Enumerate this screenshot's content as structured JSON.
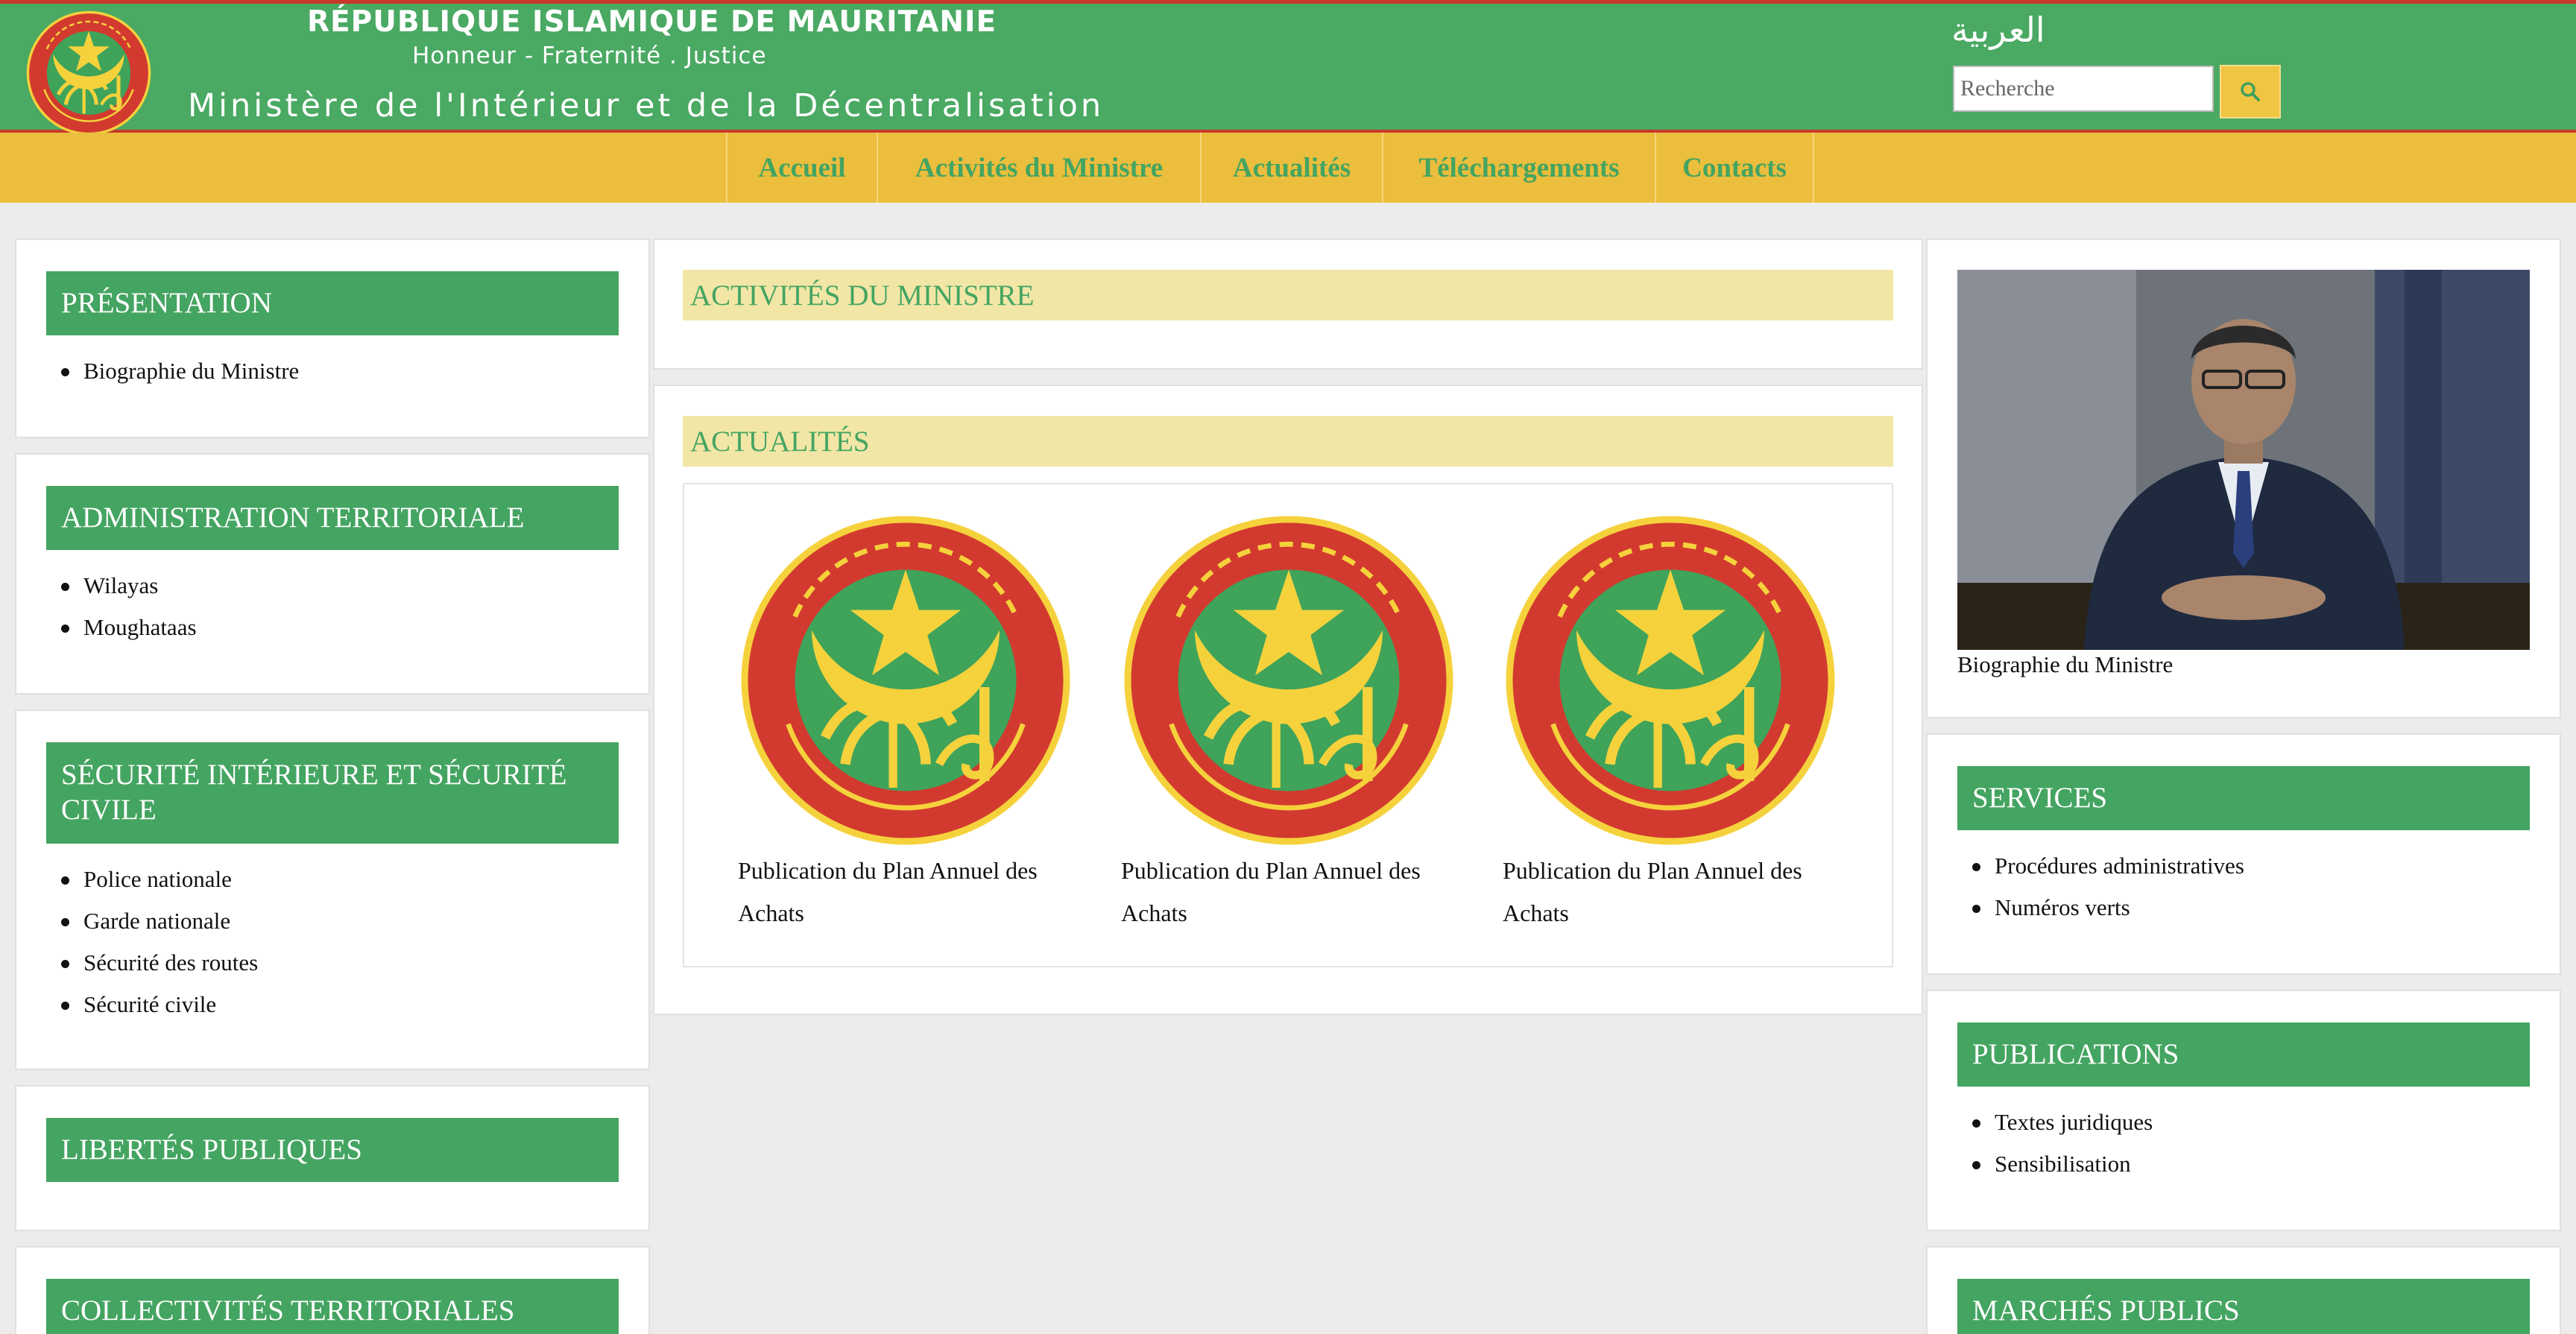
{
  "header": {
    "republic_title": "RÉPUBLIQUE ISLAMIQUE DE MAURITANIE",
    "motto": "Honneur - Fraternité . Justice",
    "ministry_title": "Ministère de l'Intérieur et de la Décentralisation",
    "language_link": "العربية",
    "search_placeholder": "Recherche",
    "search_icon": "search-icon"
  },
  "nav": {
    "items": [
      "Accueil",
      "Activités du Ministre",
      "Actualités",
      "Téléchargements",
      "Contacts"
    ]
  },
  "left_sidebar": {
    "presentation": {
      "title": "PRÉSENTATION",
      "links": [
        "Biographie du Ministre"
      ]
    },
    "administration": {
      "title": "ADMINISTRATION TERRITORIALE",
      "links": [
        "Wilayas",
        "Moughataas"
      ]
    },
    "securite": {
      "title": "SÉCURITÉ INTÉRIEURE ET SÉCURITÉ CIVILE",
      "links": [
        "Police nationale",
        "Garde nationale",
        "Sécurité des routes",
        "Sécurité civile"
      ]
    },
    "libertes": {
      "title": "LIBERTÉS PUBLIQUES"
    },
    "collectivites": {
      "title": "COLLECTIVITÉS TERRITORIALES"
    }
  },
  "main": {
    "activites_title": "ACTIVITÉS DU MINISTRE",
    "actualites_title": "ACTUALITÉS",
    "news": [
      {
        "caption": "Publication du Plan Annuel des Achats"
      },
      {
        "caption": "Publication du Plan Annuel des Achats"
      },
      {
        "caption": "Publication du Plan Annuel des Achats"
      }
    ]
  },
  "right_sidebar": {
    "minister_caption": "Biographie du Ministre",
    "services": {
      "title": "SERVICES",
      "links": [
        "Procédures administratives",
        "Numéros verts"
      ]
    },
    "publications": {
      "title": "PUBLICATIONS",
      "links": [
        "Textes juridiques",
        "Sensibilisation"
      ]
    },
    "marches": {
      "title": "MARCHÉS PUBLICS"
    }
  },
  "colors": {
    "header_green": "#4aa963",
    "nav_yellow": "#ebbe3d",
    "heading_green": "#44a461",
    "section_bar": "#f1e6a6",
    "accent_red": "#c8392b"
  }
}
